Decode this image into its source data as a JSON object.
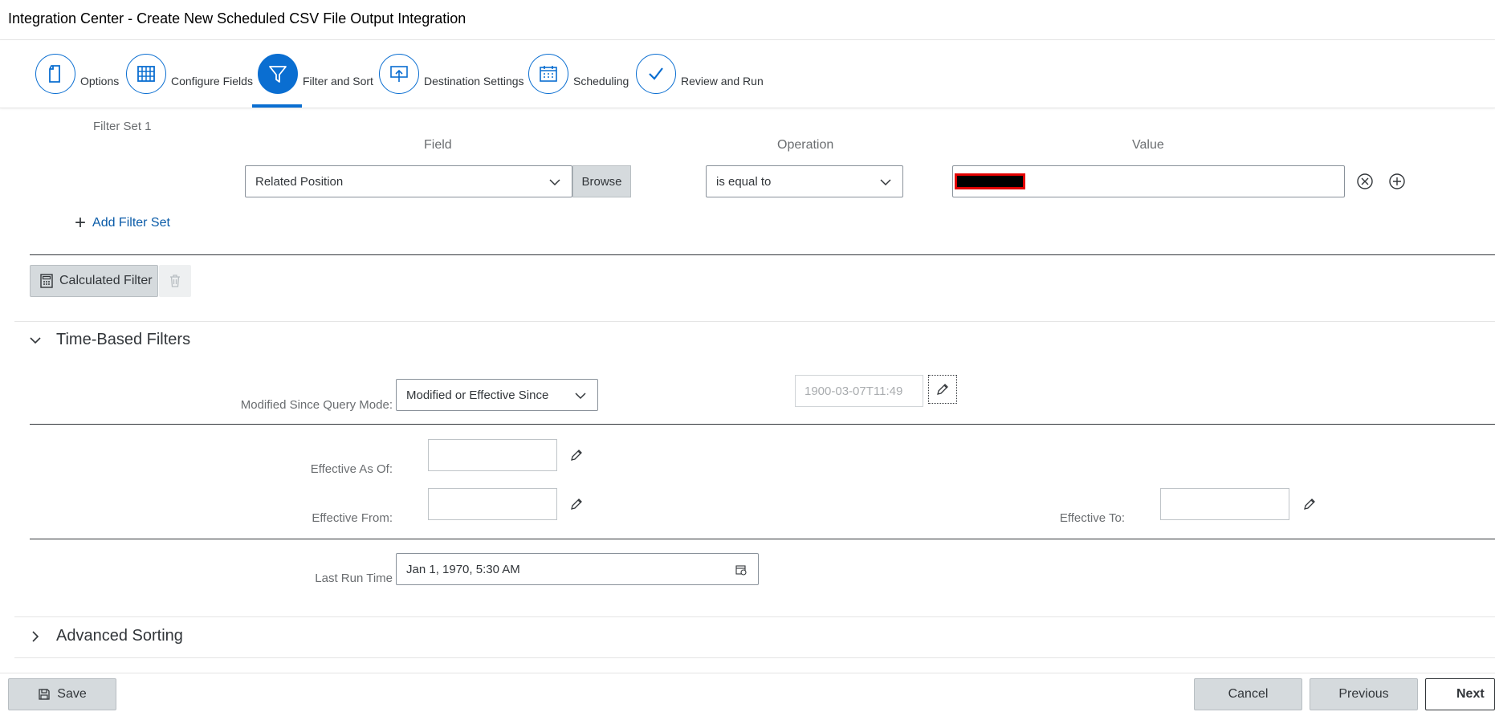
{
  "window": {
    "title": "Integration Center - Create New Scheduled CSV File Output Integration"
  },
  "wizard": {
    "steps": [
      {
        "label": "Options",
        "icon": "document-icon",
        "active": false
      },
      {
        "label": "Configure Fields",
        "icon": "table-grid-icon",
        "active": false
      },
      {
        "label": "Filter and Sort",
        "icon": "filter-icon",
        "active": true
      },
      {
        "label": "Destination Settings",
        "icon": "presentation-upload-icon",
        "active": false
      },
      {
        "label": "Scheduling",
        "icon": "calendar-icon",
        "active": false
      },
      {
        "label": "Review and Run",
        "icon": "checkmark-icon",
        "active": false
      }
    ]
  },
  "filter_set": {
    "label": "Filter Set 1",
    "columns": {
      "field": "Field",
      "operation": "Operation",
      "value": "Value"
    },
    "row": {
      "field_value": "Related Position",
      "browse_label": "Browse",
      "operation_value": "is equal to",
      "value": ""
    },
    "add_filter_set_label": "Add Filter Set"
  },
  "calculated_filter": {
    "label": "Calculated Filter"
  },
  "time_filters": {
    "title": "Time-Based Filters",
    "modified_since_label": "Modified Since Query Mode:",
    "modified_since_value": "Modified or Effective Since",
    "modified_since_date": "1900-03-07T11:49",
    "effective_as_of_label": "Effective As Of:",
    "effective_from_label": "Effective From:",
    "effective_to_label": "Effective To:",
    "last_run_label": "Last Run Time",
    "last_run_value": "Jan 1, 1970, 5:30 AM"
  },
  "advanced_sorting": {
    "title": "Advanced Sorting"
  },
  "footer": {
    "save_label": "Save",
    "cancel_label": "Cancel",
    "previous_label": "Previous",
    "next_label": "Next"
  },
  "colors": {
    "accent": "#0a6ed1",
    "redaction": "#e30000"
  }
}
